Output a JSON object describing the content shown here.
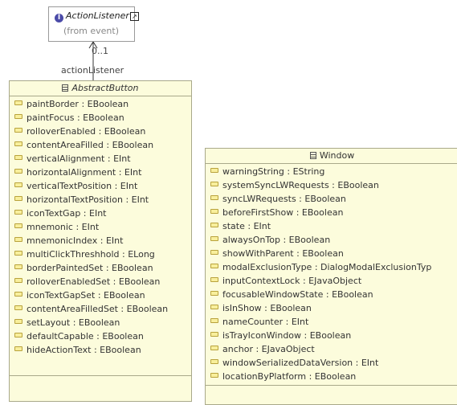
{
  "interface": {
    "name": "ActionListener",
    "package": "(from event)"
  },
  "association": {
    "role": "actionListener",
    "multiplicity": "0..1"
  },
  "abstract_button": {
    "name": "AbstractButton",
    "attributes": [
      "paintBorder : EBoolean",
      "paintFocus : EBoolean",
      "rolloverEnabled : EBoolean",
      "contentAreaFilled : EBoolean",
      "verticalAlignment : EInt",
      "horizontalAlignment : EInt",
      "verticalTextPosition : EInt",
      "horizontalTextPosition : EInt",
      "iconTextGap : EInt",
      "mnemonic : EInt",
      "mnemonicIndex : EInt",
      "multiClickThreshhold : ELong",
      "borderPaintedSet : EBoolean",
      "rolloverEnabledSet : EBoolean",
      "iconTextGapSet : EBoolean",
      "contentAreaFilledSet : EBoolean",
      "setLayout : EBoolean",
      "defaultCapable : EBoolean",
      "hideActionText : EBoolean"
    ]
  },
  "window": {
    "name": "Window",
    "attributes": [
      "warningString : EString",
      "systemSyncLWRequests : EBoolean",
      "syncLWRequests : EBoolean",
      "beforeFirstShow : EBoolean",
      "state : EInt",
      "alwaysOnTop : EBoolean",
      "showWithParent : EBoolean",
      "modalExclusionType : DialogModalExclusionTyp",
      "inputContextLock : EJavaObject",
      "focusableWindowState : EBoolean",
      "isInShow : EBoolean",
      "nameCounter : EInt",
      "isTrayIconWindow : EBoolean",
      "anchor : EJavaObject",
      "windowSerializedDataVersion : EInt",
      "locationByPlatform : EBoolean"
    ]
  },
  "colors": {
    "class_fill": "#fcfcdc",
    "class_border": "#a9a98a",
    "interface_icon": "#4b4ba8",
    "attribute_icon": "#f8ef9c"
  }
}
